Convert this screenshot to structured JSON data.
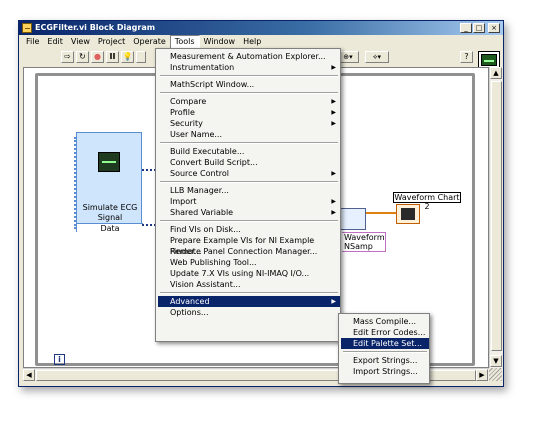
{
  "window": {
    "title": "ECGFilter.vi Block Diagram",
    "min": "_",
    "max": "□",
    "close": "×"
  },
  "menubar": [
    "File",
    "Edit",
    "View",
    "Project",
    "Operate",
    "Tools",
    "Window",
    "Help"
  ],
  "toolbar": {
    "run": "⇨",
    "run_cont": "↻",
    "abort": "●",
    "pause": "II",
    "highlight": "💡",
    "align": "⊕▾",
    "reorder": "⟡▾",
    "help": "?"
  },
  "tools_menu": [
    {
      "label": "Measurement & Automation Explorer...",
      "sub": false
    },
    {
      "label": "Instrumentation",
      "sub": true
    },
    {
      "sep": true
    },
    {
      "label": "MathScript Window...",
      "sub": false
    },
    {
      "sep": true
    },
    {
      "label": "Compare",
      "sub": true
    },
    {
      "label": "Profile",
      "sub": true
    },
    {
      "label": "Security",
      "sub": true
    },
    {
      "label": "User Name...",
      "sub": false
    },
    {
      "sep": true
    },
    {
      "label": "Build Executable...",
      "sub": false
    },
    {
      "label": "Convert Build Script...",
      "sub": false
    },
    {
      "label": "Source Control",
      "sub": true
    },
    {
      "sep": true
    },
    {
      "label": "LLB Manager...",
      "sub": false
    },
    {
      "label": "Import",
      "sub": true
    },
    {
      "label": "Shared Variable",
      "sub": true
    },
    {
      "sep": true
    },
    {
      "label": "Find VIs on Disk...",
      "sub": false
    },
    {
      "label": "Prepare Example VIs for NI Example Finder...",
      "sub": false
    },
    {
      "label": "Remote Panel Connection Manager...",
      "sub": false
    },
    {
      "label": "Web Publishing Tool...",
      "sub": false
    },
    {
      "label": "Update 7.X VIs using NI-IMAQ I/O...",
      "sub": false
    },
    {
      "label": "Vision Assistant...",
      "sub": false
    },
    {
      "sep": true
    },
    {
      "label": "Advanced",
      "sub": true,
      "highlighted": true
    },
    {
      "label": "Options...",
      "sub": false
    }
  ],
  "advanced_menu": [
    {
      "label": "Mass Compile..."
    },
    {
      "label": "Edit Error Codes..."
    },
    {
      "label": "Edit Palette Set...",
      "highlighted": true
    },
    {
      "sep": true
    },
    {
      "label": "Export Strings..."
    },
    {
      "label": "Import Strings..."
    }
  ],
  "diagram": {
    "sim_title": "Simulate ECG Signal",
    "sim_data": "Data",
    "chart_label": "Waveform Chart 2",
    "wfm_label": "Waveform NSamp",
    "info": "i"
  },
  "scroll": {
    "up": "▲",
    "down": "▼",
    "left": "◀",
    "right": "▶"
  }
}
